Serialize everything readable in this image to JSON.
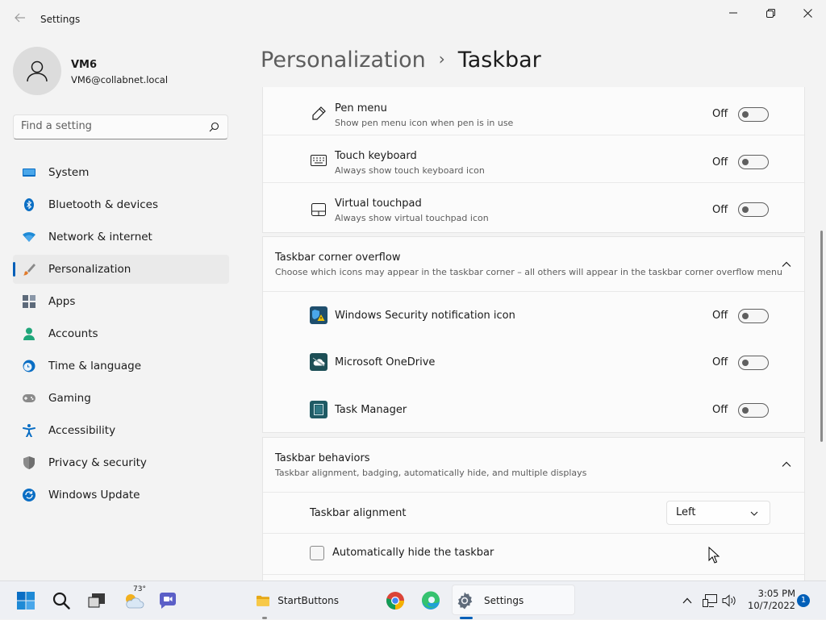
{
  "window": {
    "app_title": "Settings"
  },
  "profile": {
    "name": "VM6",
    "email": "VM6@collabnet.local"
  },
  "search": {
    "placeholder": "Find a setting"
  },
  "nav": [
    {
      "label": "System",
      "icon": "monitor-icon"
    },
    {
      "label": "Bluetooth & devices",
      "icon": "bluetooth-icon"
    },
    {
      "label": "Network & internet",
      "icon": "wifi-icon"
    },
    {
      "label": "Personalization",
      "icon": "paintbrush-icon",
      "active": true
    },
    {
      "label": "Apps",
      "icon": "apps-icon"
    },
    {
      "label": "Accounts",
      "icon": "person-icon"
    },
    {
      "label": "Time & language",
      "icon": "clock-globe-icon"
    },
    {
      "label": "Gaming",
      "icon": "gamepad-icon"
    },
    {
      "label": "Accessibility",
      "icon": "accessibility-icon"
    },
    {
      "label": "Privacy & security",
      "icon": "shield-icon"
    },
    {
      "label": "Windows Update",
      "icon": "update-icon"
    }
  ],
  "header": {
    "parent": "Personalization",
    "separator": "›",
    "current": "Taskbar"
  },
  "corner_icons": [
    {
      "title": "Pen menu",
      "subtitle": "Show pen menu icon when pen is in use",
      "state": "Off",
      "icon": "pen-icon"
    },
    {
      "title": "Touch keyboard",
      "subtitle": "Always show touch keyboard icon",
      "state": "Off",
      "icon": "keyboard-icon"
    },
    {
      "title": "Virtual touchpad",
      "subtitle": "Always show virtual touchpad icon",
      "state": "Off",
      "icon": "touchpad-icon"
    }
  ],
  "overflow": {
    "title": "Taskbar corner overflow",
    "subtitle": "Choose which icons may appear in the taskbar corner – all others will appear in the taskbar corner overflow menu",
    "items": [
      {
        "title": "Windows Security notification icon",
        "state": "Off",
        "icon": "windows-security-icon"
      },
      {
        "title": "Microsoft OneDrive",
        "state": "Off",
        "icon": "onedrive-icon"
      },
      {
        "title": "Task Manager",
        "state": "Off",
        "icon": "task-manager-icon"
      }
    ]
  },
  "behaviors": {
    "title": "Taskbar behaviors",
    "subtitle": "Taskbar alignment, badging, automatically hide, and multiple displays",
    "alignment_label": "Taskbar alignment",
    "alignment_value": "Left",
    "autohide_label": "Automatically hide the taskbar",
    "autohide_checked": false
  },
  "taskbar": {
    "weather_temp": "73°",
    "explorer_label": "StartButtons",
    "settings_label": "Settings",
    "time": "3:05 PM",
    "date": "10/7/2022",
    "notification_count": "1"
  },
  "colors": {
    "accent": "#005fb8",
    "window_bg": "#f3f3f3",
    "card_bg": "#fbfbfb"
  }
}
